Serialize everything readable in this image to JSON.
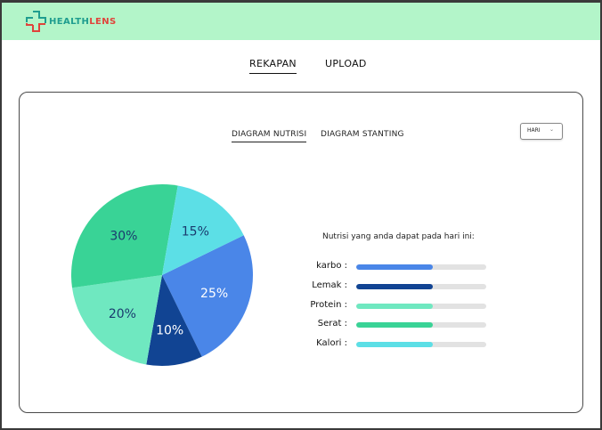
{
  "app": {
    "logo_part1": "HEALTH",
    "logo_part2": "LENS",
    "logo_color1": "#1f9d8f",
    "logo_color2": "#e0433b",
    "header_bg": "#b3f5c9"
  },
  "nav": {
    "tabs": [
      {
        "label": "REKAPAN",
        "active": true
      },
      {
        "label": "UPLOAD",
        "active": false
      }
    ]
  },
  "subtabs": [
    {
      "label": "DIAGRAM NUTRISI",
      "active": true
    },
    {
      "label": "DIAGRAM STANTING",
      "active": false
    }
  ],
  "period_select": {
    "value": "HARI",
    "icon": "chevron-down-icon"
  },
  "chart_data": {
    "type": "pie",
    "title": "",
    "slices": [
      {
        "value": 25,
        "label": "25%",
        "color": "#4a86e8"
      },
      {
        "value": 10,
        "label": "10%",
        "color": "#114493"
      },
      {
        "value": 20,
        "label": "20%",
        "color": "#6fe8c0"
      },
      {
        "value": 30,
        "label": "30%",
        "color": "#39d396"
      },
      {
        "value": 15,
        "label": "15%",
        "color": "#5cdfe6"
      }
    ],
    "start_angle_deg": -26,
    "label_colors": [
      "#ffffff",
      "#ffffff",
      "#1a3b6e",
      "#1a3b6e",
      "#1a3b6e"
    ],
    "legend": "none"
  },
  "nutrition": {
    "title": "Nutrisi yang anda dapat pada hari ini:",
    "items": [
      {
        "label": "karbo :",
        "level": 0.59,
        "color": "#4a86e8"
      },
      {
        "label": "Lemak :",
        "level": 0.59,
        "color": "#114493"
      },
      {
        "label": "Protein :",
        "level": 0.59,
        "color": "#6fe8c0"
      },
      {
        "label": "Serat :",
        "level": 0.59,
        "color": "#39d396"
      },
      {
        "label": "Kalori :",
        "level": 0.59,
        "color": "#5cdfe6"
      }
    ],
    "track_color": "#e2e2e2"
  }
}
